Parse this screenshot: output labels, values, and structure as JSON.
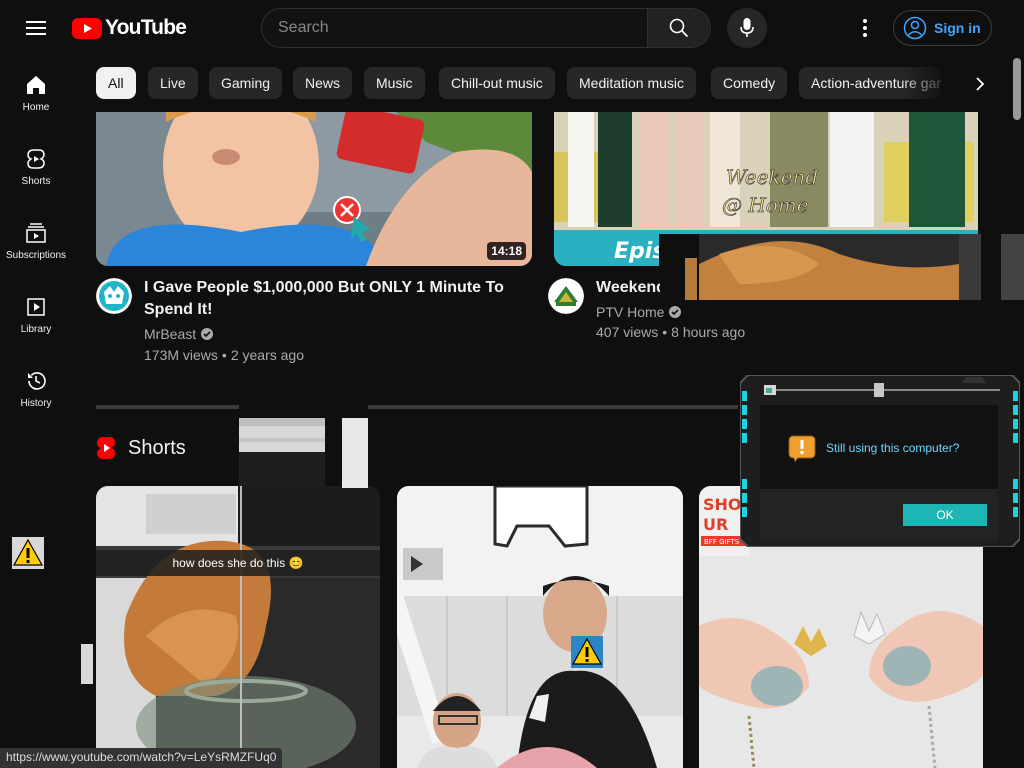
{
  "header": {
    "logo_text": "YouTube",
    "search_placeholder": "Search",
    "signin_label": "Sign in"
  },
  "sidebar": {
    "items": [
      {
        "label": "Home",
        "icon": "home-icon"
      },
      {
        "label": "Shorts",
        "icon": "shorts-icon"
      },
      {
        "label": "Subscriptions",
        "icon": "subscriptions-icon"
      },
      {
        "label": "Library",
        "icon": "library-icon"
      },
      {
        "label": "History",
        "icon": "history-icon"
      }
    ]
  },
  "chips": [
    "All",
    "Live",
    "Gaming",
    "News",
    "Music",
    "Chill-out music",
    "Meditation music",
    "Comedy",
    "Action-adventure games"
  ],
  "videos": [
    {
      "title": "I Gave People $1,000,000 But ONLY 1 Minute To Spend It!",
      "channel": "MrBeast",
      "views": "173M views",
      "age": "2 years ago",
      "duration": "14:18"
    },
    {
      "title": "Weekend",
      "channel": "PTV Home",
      "views": "407 views",
      "age": "8 hours ago",
      "thumb_text_1": "Weekend",
      "thumb_text_2": "@ Home",
      "thumb_banner": "Epis"
    }
  ],
  "shorts": {
    "heading": "Shorts",
    "caption": "how does she do this 😊",
    "third_badge_1": "SHO",
    "third_badge_2": "UR",
    "third_badge_3": "BFF GIFTS"
  },
  "dialog": {
    "message": "Still using this computer?",
    "ok_label": "OK"
  },
  "status_url": "https://www.youtube.com/watch?v=LeYsRMZFUq0",
  "colors": {
    "background": "#0f0f0f",
    "brand_red": "#ff0000",
    "link_blue": "#3ea6ff",
    "chip_bg": "#272727",
    "dialog_teal": "#1fb5b5"
  }
}
